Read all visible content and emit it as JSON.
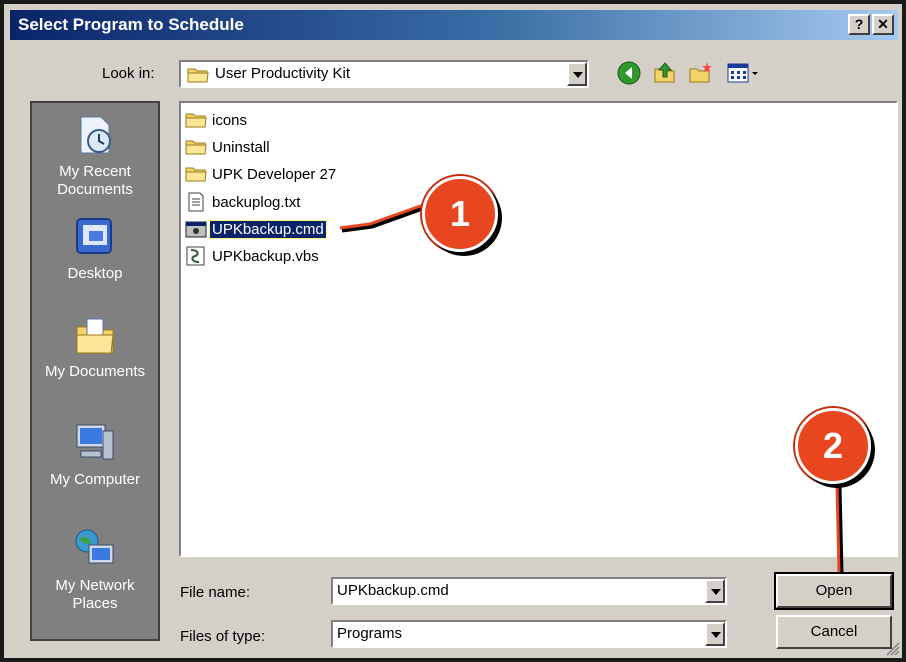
{
  "window": {
    "title": "Select Program to Schedule",
    "help_button": "?",
    "close_button": "✕"
  },
  "lookin": {
    "label": "Look in:",
    "value": "User Productivity Kit"
  },
  "places": [
    {
      "label": "My Recent Documents",
      "icon": "recent-documents-icon"
    },
    {
      "label": "Desktop",
      "icon": "desktop-icon"
    },
    {
      "label": "My Documents",
      "icon": "my-documents-icon"
    },
    {
      "label": "My Computer",
      "icon": "my-computer-icon"
    },
    {
      "label": "My Network Places",
      "icon": "network-places-icon"
    }
  ],
  "files": [
    {
      "name": "icons",
      "type": "folder"
    },
    {
      "name": "Uninstall",
      "type": "folder"
    },
    {
      "name": "UPK Developer 27",
      "type": "folder"
    },
    {
      "name": "backuplog.txt",
      "type": "text"
    },
    {
      "name": "UPKbackup.cmd",
      "type": "cmd",
      "selected": true
    },
    {
      "name": "UPKbackup.vbs",
      "type": "vbs"
    }
  ],
  "filename": {
    "label": "File name:",
    "value": "UPKbackup.cmd"
  },
  "filetype": {
    "label": "Files of type:",
    "value": "Programs"
  },
  "buttons": {
    "open": "Open",
    "cancel": "Cancel"
  },
  "callouts": [
    "1",
    "2"
  ],
  "colors": {
    "titlebar": "#0a246a",
    "selection": "#0a246a",
    "callout": "#e8461e",
    "places_bar": "#808080",
    "dialog_face": "#d4d0c8"
  }
}
